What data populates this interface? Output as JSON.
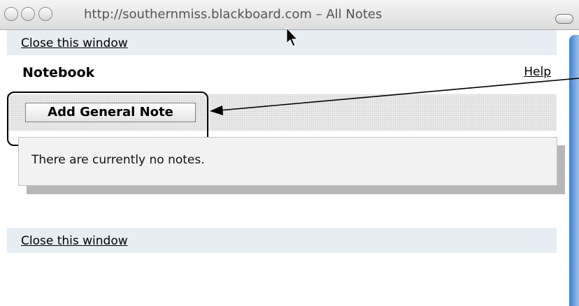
{
  "window": {
    "title": "http://southernmiss.blackboard.com – All Notes"
  },
  "page": {
    "close_window_top": "Close this window",
    "close_window_bottom": "Close this window",
    "heading": "Notebook",
    "help_link": "Help",
    "add_note_button": "Add General Note",
    "empty_message": "There are currently no notes."
  },
  "icons": [
    "close-traffic-light-icon",
    "minimize-traffic-light-icon",
    "zoom-traffic-light-icon",
    "toolbar-toggle-icon",
    "mouse-pointer-icon",
    "annotation-arrow-icon"
  ],
  "colors": {
    "link_band": "#e6edf3",
    "panel": "#f2f2f2",
    "scrollbar": "#3d7ed0"
  }
}
